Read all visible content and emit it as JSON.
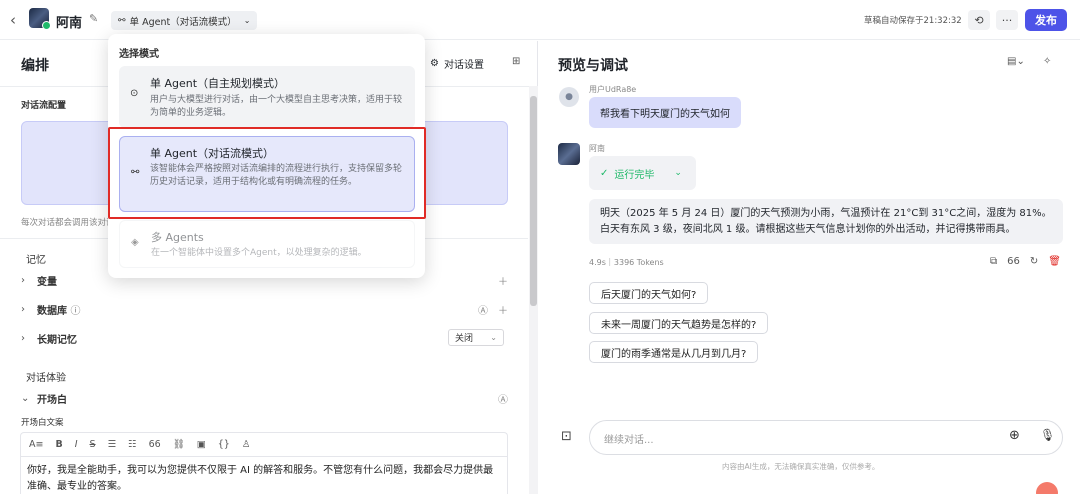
{
  "header": {
    "agent_name": "阿南",
    "mode_label": "单 Agent（对话流模式）",
    "draft_status": "草稿自动保存于21:32:32",
    "publish_label": "发布"
  },
  "left": {
    "title": "编排",
    "settings_label": "对话设置",
    "flow_config_title": "对话流配置",
    "flow_config_note": "每次对话都会调用该对话",
    "memory_title": "记忆",
    "memory_items": [
      "变量",
      "数据库",
      "长期记忆"
    ],
    "long_term_value": "关闭",
    "experience_title": "对话体验",
    "opening_label": "开场白",
    "opening_text_label": "开场白文案",
    "opening_text": "你好，我是全能助手，我可以为您提供不仅限于 AI 的解答和服务。不管您有什么问题，我都会尽力提供最准确、最专业的答案。",
    "editor_tools": [
      "A≡",
      "B",
      "I",
      "S",
      "☰",
      "☷",
      "66",
      "⛓",
      "▣",
      "{}",
      "♙"
    ]
  },
  "popup": {
    "title": "选择模式",
    "options": [
      {
        "title": "单 Agent（自主规划模式）",
        "desc": "用户与大模型进行对话，由一个大模型自主思考决策，适用于较为简单的业务逻辑。",
        "icon": "robot-icon"
      },
      {
        "title": "单 Agent（对话流模式）",
        "desc": "该智能体会严格按照对话流编排的流程进行执行，支持保留多轮历史对话记录，适用于结构化或有明确流程的任务。",
        "icon": "workflow-icon"
      },
      {
        "title": "多 Agents",
        "desc": "在一个智能体中设置多个Agent，以处理复杂的逻辑。",
        "icon": "layers-icon"
      }
    ]
  },
  "right": {
    "title": "预览与调试",
    "user_name": "用户UdRa8e",
    "user_message": "帮我看下明天厦门的天气如何",
    "bot_name": "阿南",
    "run_status": "运行完毕",
    "bot_reply": "明天（2025 年 5 月 24 日）厦门的天气预测为小雨，气温预计在 21°C到 31°C之间，湿度为 81%。白天有东风 3 级，夜间北风 1 级。请根据这些天气信息计划你的外出活动，并记得携带雨具。",
    "meta": "4.9s｜3396 Tokens",
    "suggestions": [
      "后天厦门的天气如何?",
      "未来一周厦门的天气趋势是怎样的?",
      "厦门的雨季通常是从几月到几月?"
    ],
    "input_placeholder": "继续对话...",
    "disclaimer": "内容由AI生成，无法确保真实准确，仅供参考。"
  },
  "colors": {
    "accent": "#4d53e8",
    "highlight": "#e02b26",
    "success": "#20b96a"
  }
}
